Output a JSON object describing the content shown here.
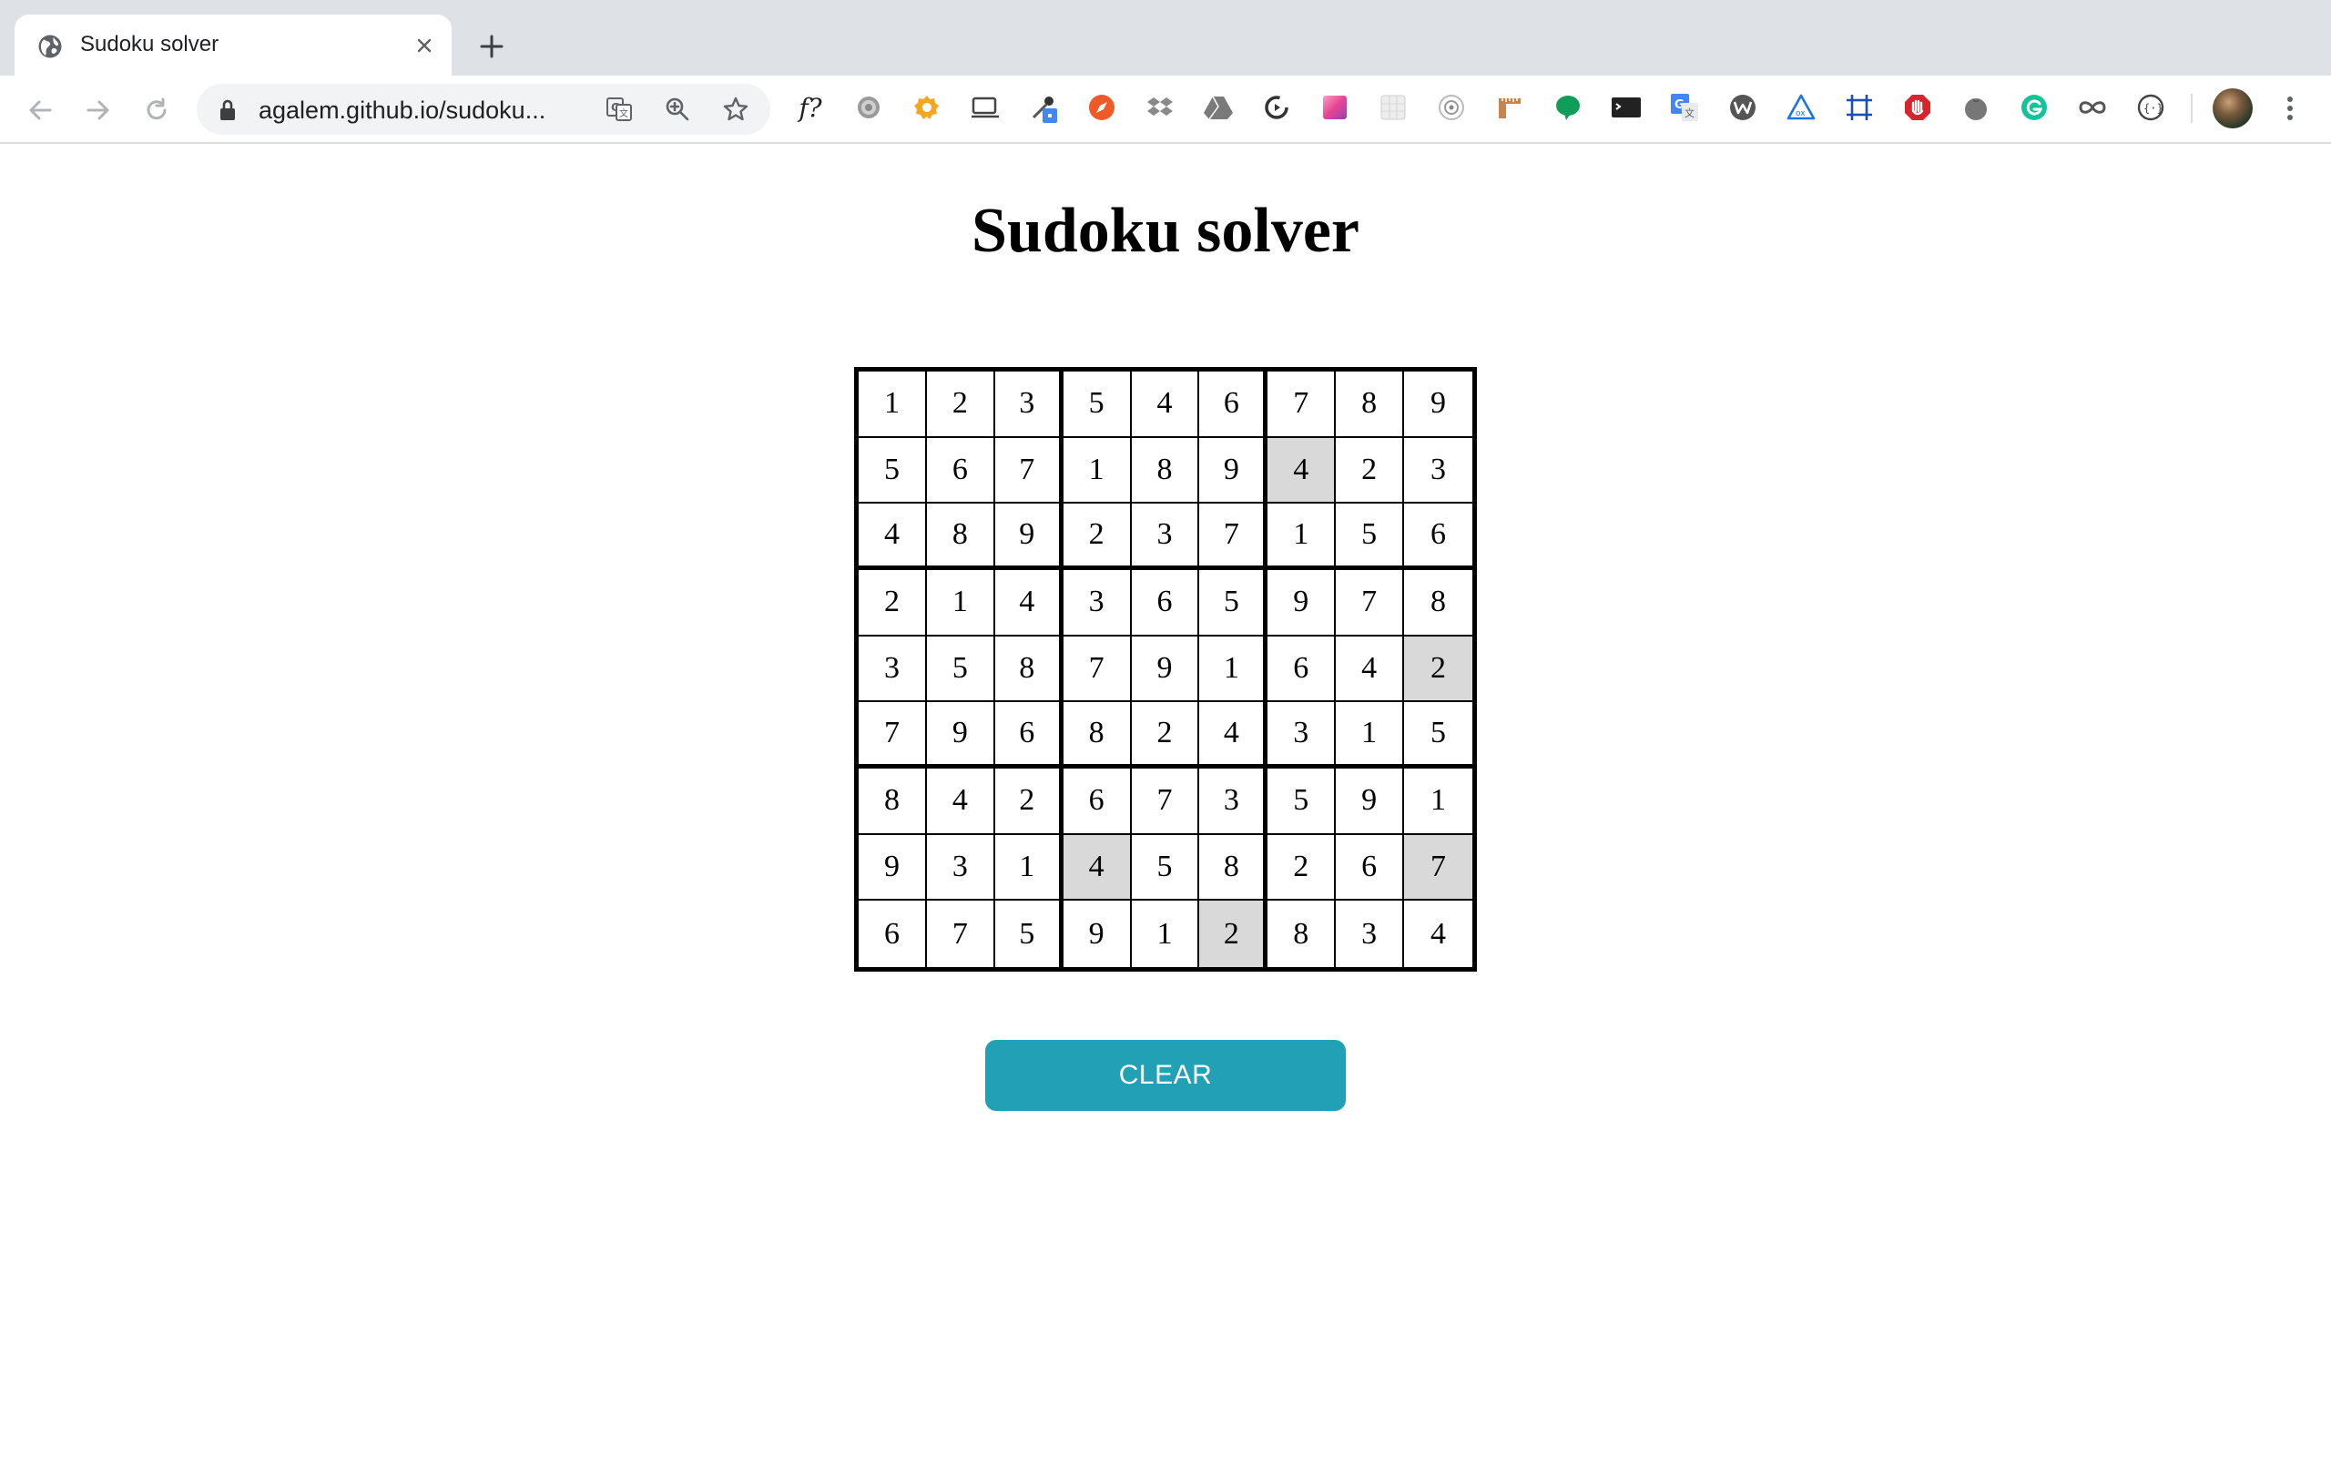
{
  "browser": {
    "tab_title": "Sudoku solver",
    "url": "agalem.github.io/sudoku...",
    "extensions": [
      {
        "name": "f-question-ext",
        "text": "f?",
        "color": "#222222"
      },
      {
        "name": "gear-ext-icon",
        "color": "#8a8a8a"
      },
      {
        "name": "orange-gear-ext-icon",
        "color": "#f5a623"
      },
      {
        "name": "cast-ext-icon",
        "color": "#444444"
      },
      {
        "name": "eyedropper-ext-icon",
        "color": "#4285f4"
      },
      {
        "name": "compass-ext-icon",
        "color": "#f05a28"
      },
      {
        "name": "dropbox-ext-icon",
        "color": "#8a8a8a"
      },
      {
        "name": "drive-ext-icon",
        "color": "#7a7a7a"
      },
      {
        "name": "sync-ext-icon",
        "color": "#333333"
      },
      {
        "name": "gradient-ext-icon",
        "color": "#e84393"
      },
      {
        "name": "grid-ext-icon",
        "color": "#cccccc"
      },
      {
        "name": "target-ext-icon",
        "color": "#aaaaaa"
      },
      {
        "name": "ruler-ext-icon",
        "color": "#c8844a"
      },
      {
        "name": "chat-ext-icon",
        "color": "#0f9d58"
      },
      {
        "name": "terminal-ext-icon",
        "color": "#222222"
      },
      {
        "name": "translate-ext-icon",
        "color": "#4285f4"
      },
      {
        "name": "w-ext-icon",
        "color": "#555555"
      },
      {
        "name": "triangle-ext-icon",
        "color": "#1a73e8"
      },
      {
        "name": "crop-ext-icon",
        "color": "#1a4fb0"
      },
      {
        "name": "adblock-ext-icon",
        "color": "#d9232d"
      },
      {
        "name": "tomato-ext-icon",
        "color": "#666666"
      },
      {
        "name": "grammarly-ext-icon",
        "color": "#15c39a"
      },
      {
        "name": "infinity-ext-icon",
        "color": "#555555"
      },
      {
        "name": "json-ext-icon",
        "color": "#444444"
      }
    ]
  },
  "page": {
    "title": "Sudoku solver",
    "clear_label": "CLEAR",
    "accent_color": "#22a0b5",
    "highlight_color": "#d9d9d9"
  },
  "board": {
    "rows": [
      [
        1,
        2,
        3,
        5,
        4,
        6,
        7,
        8,
        9
      ],
      [
        5,
        6,
        7,
        1,
        8,
        9,
        4,
        2,
        3
      ],
      [
        4,
        8,
        9,
        2,
        3,
        7,
        1,
        5,
        6
      ],
      [
        2,
        1,
        4,
        3,
        6,
        5,
        9,
        7,
        8
      ],
      [
        3,
        5,
        8,
        7,
        9,
        1,
        6,
        4,
        2
      ],
      [
        7,
        9,
        6,
        8,
        2,
        4,
        3,
        1,
        5
      ],
      [
        8,
        4,
        2,
        6,
        7,
        3,
        5,
        9,
        1
      ],
      [
        9,
        3,
        1,
        4,
        5,
        8,
        2,
        6,
        7
      ],
      [
        6,
        7,
        5,
        9,
        1,
        2,
        8,
        3,
        4
      ]
    ],
    "highlighted": [
      [
        1,
        6
      ],
      [
        4,
        8
      ],
      [
        7,
        3
      ],
      [
        7,
        8
      ],
      [
        8,
        5
      ]
    ]
  }
}
